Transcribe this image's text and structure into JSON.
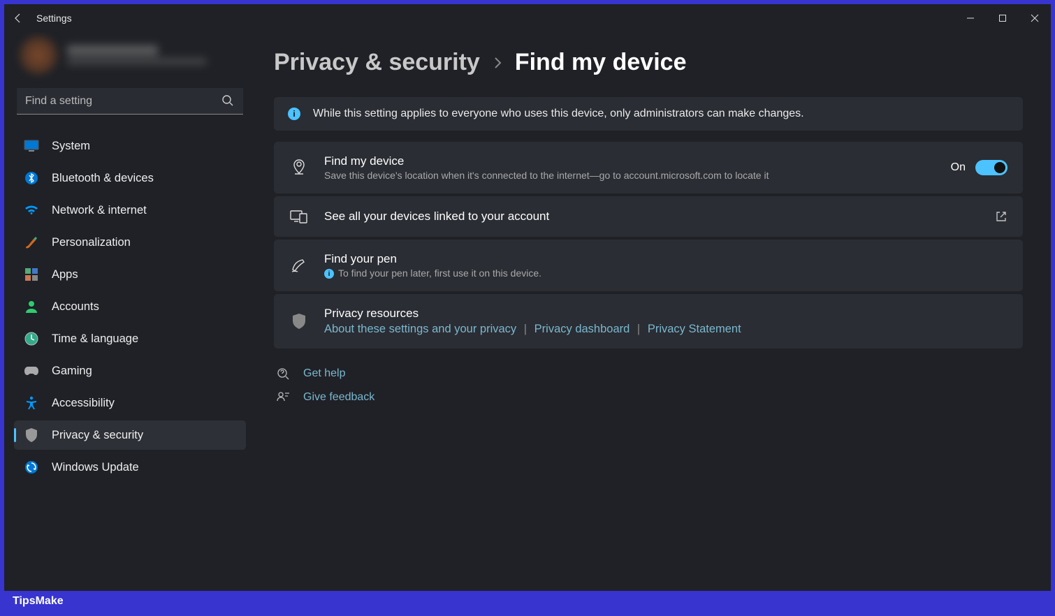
{
  "titlebar": {
    "title": "Settings"
  },
  "search": {
    "placeholder": "Find a setting"
  },
  "sidebar": {
    "items": [
      {
        "label": "System"
      },
      {
        "label": "Bluetooth & devices"
      },
      {
        "label": "Network & internet"
      },
      {
        "label": "Personalization"
      },
      {
        "label": "Apps"
      },
      {
        "label": "Accounts"
      },
      {
        "label": "Time & language"
      },
      {
        "label": "Gaming"
      },
      {
        "label": "Accessibility"
      },
      {
        "label": "Privacy & security"
      },
      {
        "label": "Windows Update"
      }
    ]
  },
  "breadcrumb": {
    "parent": "Privacy & security",
    "current": "Find my device"
  },
  "banner": {
    "text": "While this setting applies to everyone who uses this device, only administrators can make changes."
  },
  "find_device": {
    "title": "Find my device",
    "sub": "Save this device's location when it's connected to the internet—go to account.microsoft.com to locate it",
    "toggle_label": "On"
  },
  "linked_devices": {
    "title": "See all your devices linked to your account"
  },
  "find_pen": {
    "title": "Find your pen",
    "sub": "To find your pen later, first use it on this device."
  },
  "privacy_resources": {
    "title": "Privacy resources",
    "link1": "About these settings and your privacy",
    "link2": "Privacy dashboard",
    "link3": "Privacy Statement"
  },
  "help": {
    "get_help": "Get help",
    "feedback": "Give feedback"
  },
  "footer": {
    "text": "TipsMake"
  }
}
